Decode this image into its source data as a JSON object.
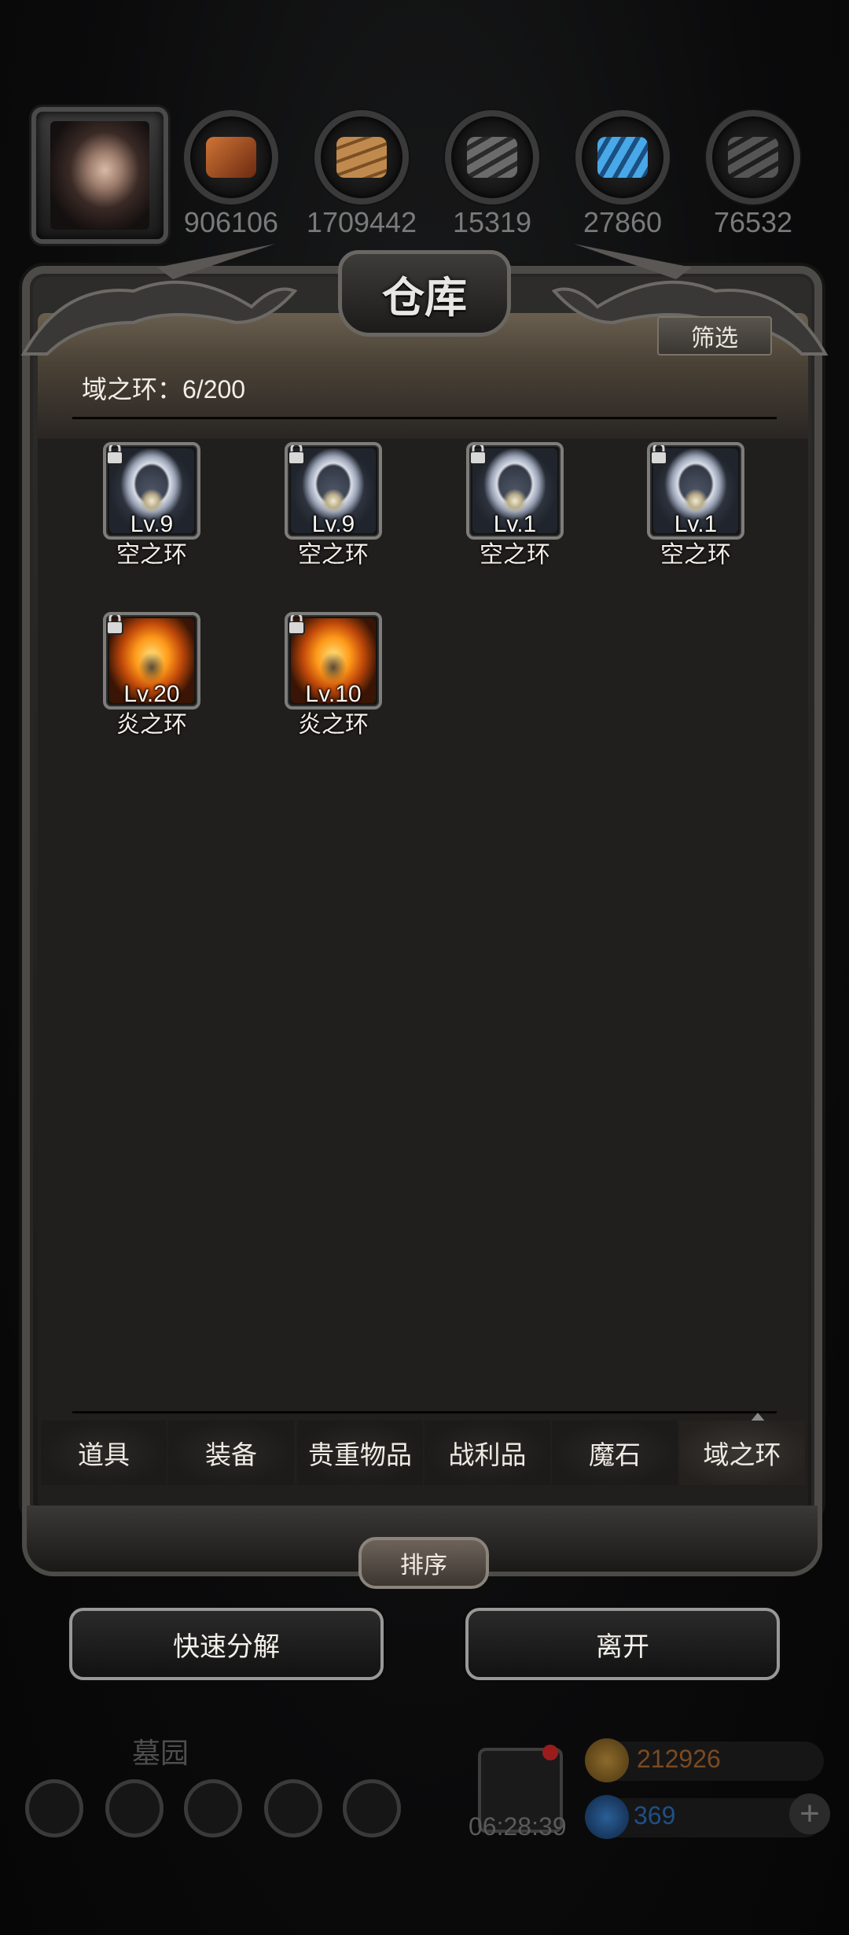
{
  "resources": [
    {
      "icon": "avatar-portrait"
    },
    {
      "icon": "leather-icon",
      "value": "906106",
      "color": "#b2501f"
    },
    {
      "icon": "wood-plank-icon",
      "value": "1709442",
      "color": "#a7723d"
    },
    {
      "icon": "iron-ingot-icon",
      "value": "15319",
      "color": "#4b4b4b"
    },
    {
      "icon": "blue-crystal-icon",
      "value": "27860",
      "color": "#2e88c7"
    },
    {
      "icon": "dark-metal-icon",
      "value": "76532",
      "color": "#3a3a3a"
    }
  ],
  "panel": {
    "title": "仓库",
    "filter_label": "筛选",
    "count_label": "域之环：6/200"
  },
  "items": [
    {
      "level": "Lv.9",
      "name": "空之环",
      "type": "sky",
      "locked": true
    },
    {
      "level": "Lv.9",
      "name": "空之环",
      "type": "sky",
      "locked": true
    },
    {
      "level": "Lv.1",
      "name": "空之环",
      "type": "sky",
      "locked": true
    },
    {
      "level": "Lv.1",
      "name": "空之环",
      "type": "sky",
      "locked": true
    },
    {
      "level": "Lv.20",
      "name": "炎之环",
      "type": "fire",
      "locked": true
    },
    {
      "level": "Lv.10",
      "name": "炎之环",
      "type": "fire",
      "locked": true
    }
  ],
  "tabs": [
    {
      "label": "道具",
      "active": false
    },
    {
      "label": "装备",
      "active": false
    },
    {
      "label": "贵重物品",
      "active": false
    },
    {
      "label": "战利品",
      "active": false
    },
    {
      "label": "魔石",
      "active": false
    },
    {
      "label": "域之环",
      "active": true
    }
  ],
  "sort_label": "排序",
  "actions": {
    "quick_decompose": "快速分解",
    "leave": "离开"
  },
  "background_hud": {
    "location": "墓园",
    "timer": "06:28:39",
    "gold": "212926",
    "gems": "369",
    "gold_color": "#7a4a22",
    "gem_color": "#1f4f86"
  }
}
